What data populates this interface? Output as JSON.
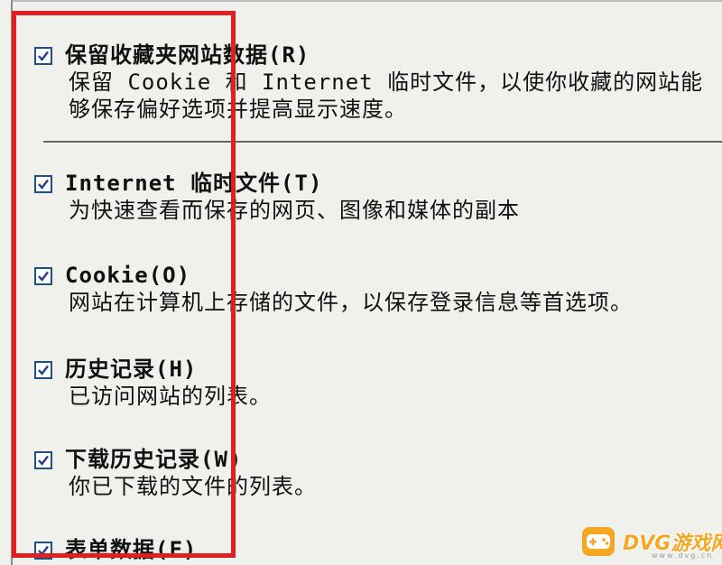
{
  "options": [
    {
      "label": "保留收藏夹网站数据(R)",
      "description": "保留 Cookie 和 Internet 临时文件，以使你收藏的网站能够保存偏好选项并提高显示速度。",
      "checked": true
    },
    {
      "label": "Internet 临时文件(T)",
      "description": "为快速查看而保存的网页、图像和媒体的副本",
      "checked": true
    },
    {
      "label": "Cookie(O)",
      "description": "网站在计算机上存储的文件，以保存登录信息等首选项。",
      "checked": true
    },
    {
      "label": "历史记录(H)",
      "description": "已访问网站的列表。",
      "checked": true
    },
    {
      "label": "下载历史记录(W)",
      "description": "你已下载的文件的列表。",
      "checked": true
    },
    {
      "label": "表单数据(F)",
      "description": "",
      "checked": true
    }
  ],
  "colors": {
    "highlight": "#e02020",
    "checkbox_border": "#1c5180",
    "check_mark": "#1f3f8c",
    "watermark": "#f5a623"
  },
  "watermark": {
    "text": "DVG游戏网",
    "url": "www.dvg.cn",
    "icon": "gamepad-icon"
  }
}
